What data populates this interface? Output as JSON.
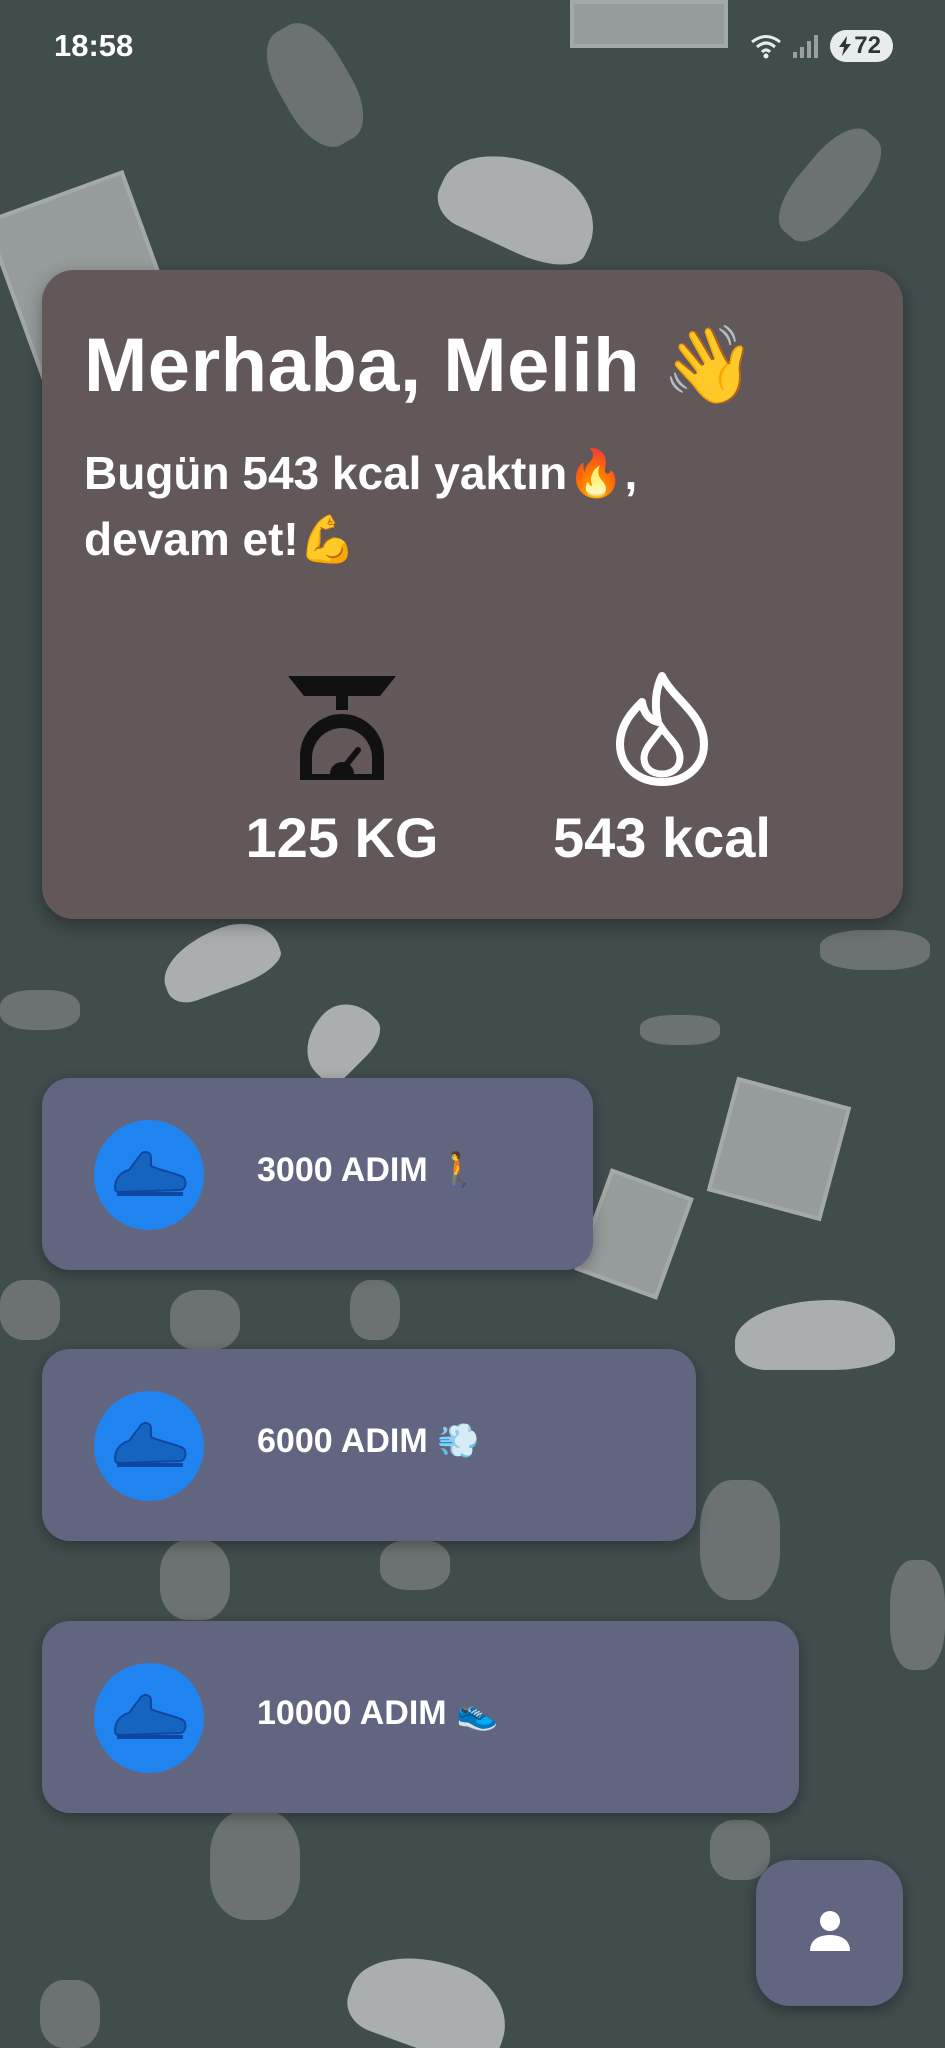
{
  "status_bar": {
    "time": "18:58",
    "battery": "72"
  },
  "hero": {
    "greeting": "Merhaba, Melih 👋",
    "message": "Bugün 543 kcal yaktın🔥, devam et!💪",
    "stats": {
      "weight": "125 KG",
      "calories": "543 kcal"
    }
  },
  "goals": [
    {
      "label": "3000 ADIM 🚶"
    },
    {
      "label": "6000 ADIM 💨"
    },
    {
      "label": "10000 ADIM 👟"
    }
  ],
  "colors": {
    "background": "#414c4c",
    "hero_card": "#625759",
    "goal_card": "#626580",
    "accent_blue": "#1f84f0"
  },
  "icons": {
    "weight": "kitchen-scale-icon",
    "calories": "flame-icon",
    "goal": "running-shoe-icon",
    "profile": "person-icon"
  }
}
